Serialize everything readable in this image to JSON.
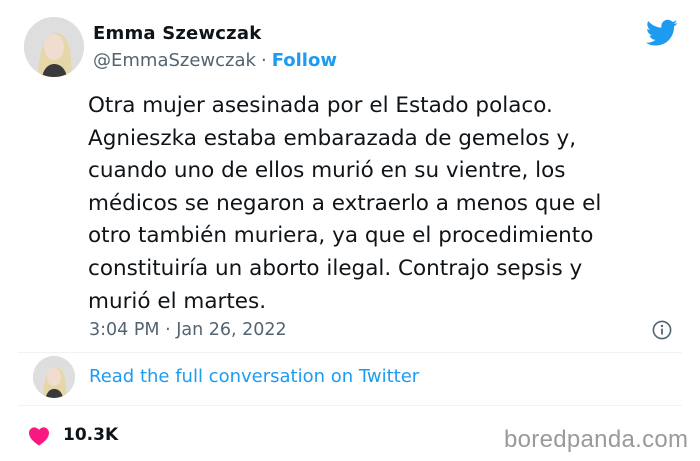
{
  "author": {
    "name": "Emma Szewczak",
    "handle": "@EmmaSzewczak",
    "separator": "·",
    "follow_label": "Follow",
    "avatar_icon": "profile-photo"
  },
  "brand": {
    "icon": "twitter-bird-icon",
    "color": "#1d9bf0"
  },
  "tweet": {
    "lines": [
      "Otra mujer asesinada por el Estado polaco.",
      "Agnieszka estaba embarazada de gemelos y,",
      "cuando uno de ellos murió en su vientre, los",
      "médicos se negaron a extraerlo a menos que el",
      "otro también muriera, ya que el procedimiento",
      "constituiría un aborto ilegal. Contrajo sepsis y",
      "murió el martes."
    ],
    "timestamp": "3:04 PM · Jan 26, 2022"
  },
  "footer": {
    "read_link": "Read the full conversation on Twitter",
    "likes": "10.3K",
    "like_color": "#f91880"
  },
  "watermark": "boredpanda.com"
}
